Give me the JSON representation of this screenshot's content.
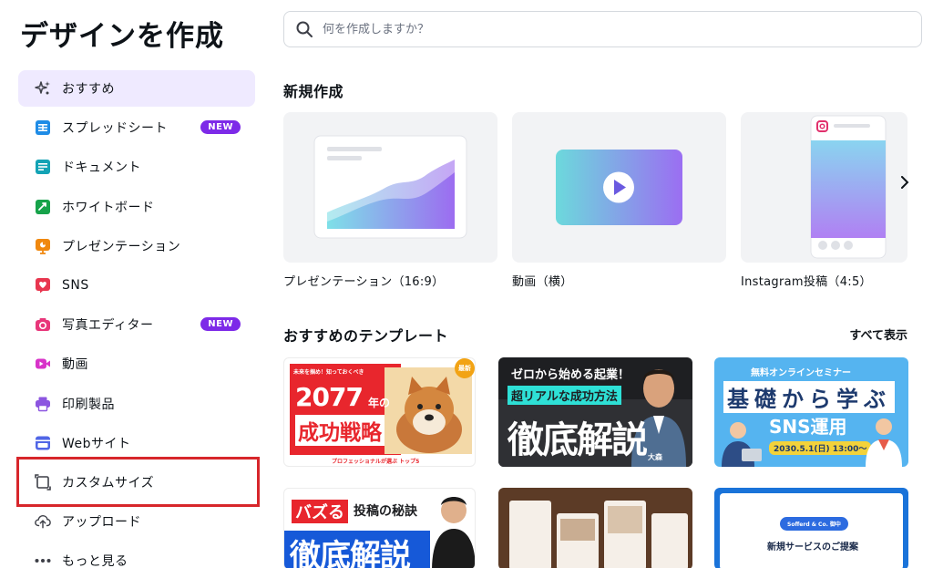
{
  "page": {
    "title": "デザインを作成"
  },
  "search": {
    "placeholder": "何を作成しますか？"
  },
  "sidebar": {
    "items": [
      {
        "label": "おすすめ",
        "icon": "sparkle-icon",
        "active": true
      },
      {
        "label": "スプレッドシート",
        "icon": "spreadsheet-icon",
        "badge": "NEW"
      },
      {
        "label": "ドキュメント",
        "icon": "document-icon"
      },
      {
        "label": "ホワイトボード",
        "icon": "whiteboard-icon"
      },
      {
        "label": "プレゼンテーション",
        "icon": "presentation-icon"
      },
      {
        "label": "SNS",
        "icon": "heart-icon"
      },
      {
        "label": "写真エディター",
        "icon": "camera-icon",
        "badge": "NEW"
      },
      {
        "label": "動画",
        "icon": "video-icon"
      },
      {
        "label": "印刷製品",
        "icon": "printer-icon"
      },
      {
        "label": "Webサイト",
        "icon": "website-icon"
      },
      {
        "label": "カスタムサイズ",
        "icon": "custom-size-icon"
      },
      {
        "label": "アップロード",
        "icon": "upload-cloud-icon"
      },
      {
        "label": "もっと見る",
        "icon": "more-dots-icon"
      }
    ]
  },
  "new_design": {
    "title": "新規作成",
    "cards": [
      {
        "label": "プレゼンテーション（16:9）"
      },
      {
        "label": "動画（横）"
      },
      {
        "label": "Instagram投稿（4:5）"
      }
    ]
  },
  "templates": {
    "title": "おすすめのテンプレート",
    "see_all": "すべて表示",
    "items": [
      {
        "lines": [
          "未来を掴め！知っておくべき",
          "2077",
          "年の",
          "成功戦略",
          "プロフェッショナルが選ぶ トップ5"
        ],
        "badge": "最新"
      },
      {
        "lines": [
          "ゼロから始める起業！",
          "超リアルな成功方法",
          "徹底解説",
          "大森"
        ]
      },
      {
        "lines": [
          "無料オンラインセミナー",
          "基礎から学ぶ",
          "SNS運用",
          "2030.5.1(日) 13:00〜"
        ]
      },
      {
        "lines": [
          "バズる",
          "投稿の秘訣",
          "徹底解説"
        ]
      },
      {
        "lines": []
      },
      {
        "lines": [
          "Sofferd & Co. 御中",
          "新規サービスのご提案"
        ]
      }
    ]
  },
  "colors": {
    "accent": "#7d2ae8",
    "active_bg": "#efeaff",
    "highlight": "#d7262b"
  }
}
